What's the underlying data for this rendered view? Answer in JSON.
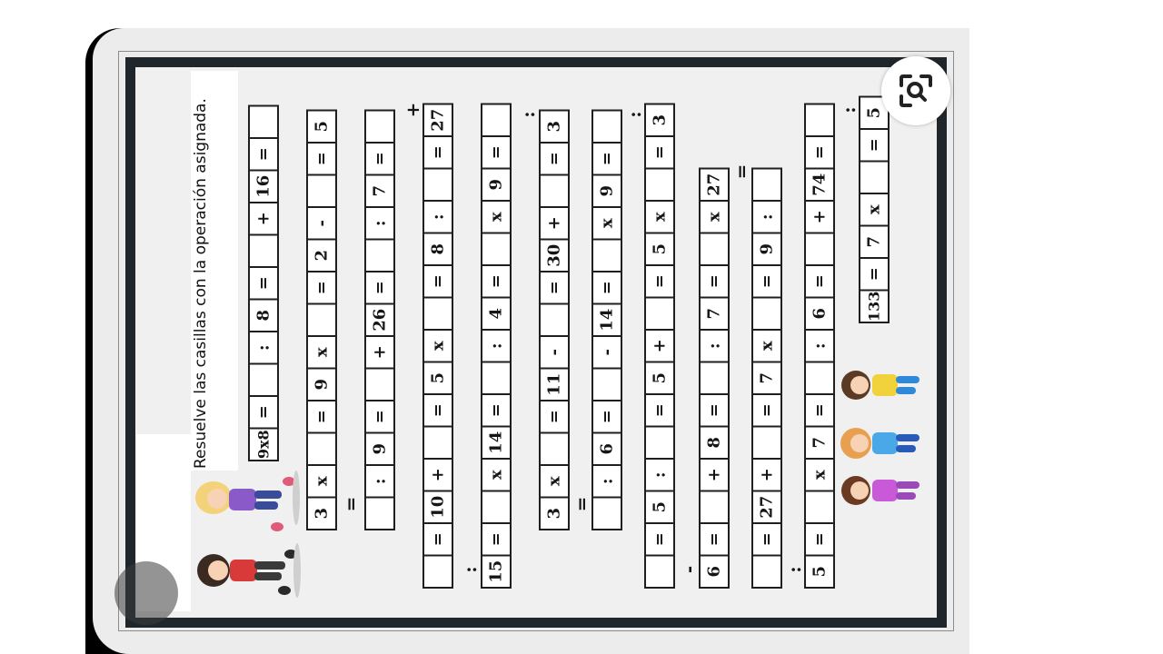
{
  "instruction": "Resuelve las casillas con la operación asignada.",
  "colors": {
    "frame": "#20272c",
    "paper": "#f0f0f0",
    "cell_border": "#1f1f1f"
  },
  "icons": [
    "lens-search-icon",
    "kids-illustration"
  ],
  "strips": [
    {
      "cells": [
        "9x8",
        "=",
        "",
        ":",
        "8",
        "=",
        "",
        "+",
        "16",
        "=",
        ""
      ]
    },
    {
      "cells": [
        "3",
        "x",
        "",
        "=",
        "9",
        "x",
        "",
        "=",
        "2",
        "-",
        "",
        "=",
        "5"
      ]
    },
    {
      "cells": [
        "",
        ":",
        "9",
        "=",
        "",
        "+",
        "26",
        "=",
        "",
        ":",
        "7",
        "=",
        ""
      ]
    },
    {
      "cells": [
        "",
        "=",
        "10",
        "+",
        "",
        "=",
        "5",
        "x",
        "",
        "=",
        "8",
        ":",
        "",
        "=",
        "27"
      ]
    },
    {
      "cells": [
        "15",
        "=",
        "",
        "x",
        "14",
        "=",
        "",
        ":",
        "4",
        "=",
        "",
        "x",
        "9",
        "=",
        ""
      ]
    },
    {
      "cells": [
        "3",
        "x",
        "",
        "=",
        "11",
        "-",
        "",
        "=",
        "30",
        "+",
        "",
        "=",
        "3"
      ]
    },
    {
      "cells": [
        "",
        ":",
        "6",
        "=",
        "",
        "-",
        "14",
        "=",
        "",
        "x",
        "9",
        "=",
        ""
      ]
    },
    {
      "cells": [
        "",
        "=",
        "5",
        ":",
        "",
        "=",
        "5",
        "+",
        "",
        "=",
        "5",
        "x",
        "",
        "=",
        "3"
      ]
    },
    {
      "cells": [
        "6",
        "=",
        "",
        "+",
        "8",
        "=",
        "",
        ":",
        "7",
        "=",
        "",
        "x",
        "27"
      ]
    },
    {
      "cells": [
        "",
        "=",
        "27",
        "+",
        "",
        "=",
        "7",
        "x",
        "",
        "=",
        "9",
        ":",
        ""
      ]
    },
    {
      "cells": [
        "5",
        "=",
        "",
        "x",
        "7",
        "=",
        "",
        ":",
        "6",
        "=",
        "",
        "+",
        "74",
        "=",
        ""
      ]
    },
    {
      "cells": [
        "133",
        "=",
        "7",
        "x",
        "",
        "=",
        "5"
      ]
    }
  ],
  "connectors": [
    {
      "label": "="
    },
    {
      "label": "+"
    },
    {
      "label": ":"
    },
    {
      "label": ":"
    },
    {
      "label": "="
    },
    {
      "label": ":"
    },
    {
      "label": "-"
    },
    {
      "label": "="
    },
    {
      "label": ":"
    },
    {
      "label": ":"
    },
    {
      "label": ":"
    }
  ]
}
